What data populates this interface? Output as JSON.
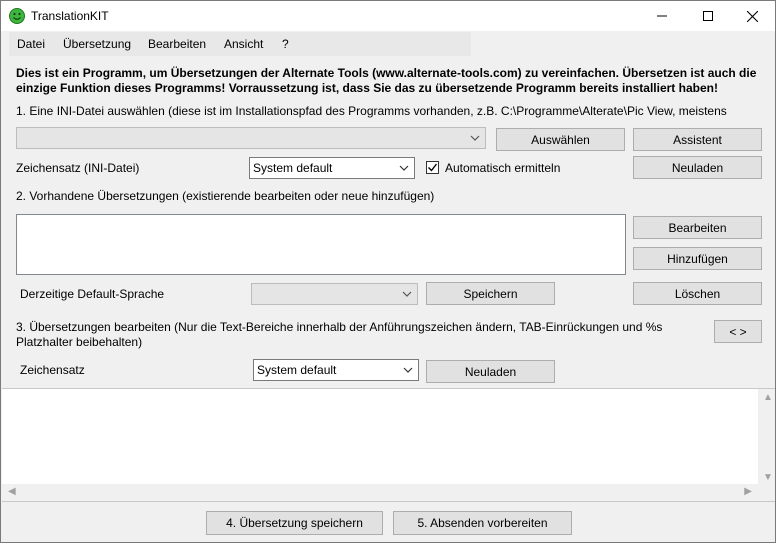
{
  "window": {
    "title": "TranslationKIT",
    "icon": "smiley-icon",
    "controls": [
      "minimize-icon",
      "maximize-icon",
      "close-icon"
    ]
  },
  "menu": [
    "Datei",
    "Übersetzung",
    "Bearbeiten",
    "Ansicht",
    "?"
  ],
  "intro": {
    "line1": "Dies ist ein Programm, um Übersetzungen der Alternate Tools (www.alternate-tools.com) zu vereinfachen. Übersetzen ist auch die",
    "line2": "einzige Funktion dieses Programms! Vorraussetzung ist, dass Sie das zu übersetzende Programm bereits installiert haben!"
  },
  "step1": {
    "label": "1. Eine INI-Datei auswählen (diese ist im Installationspfad des Programms vorhanden, z.B. C:\\Programme\\Alterate\\Pic View, meistens",
    "ini_value": "",
    "select_button": "Auswählen",
    "wizard_button": "Assistent",
    "charset_label": "Zeichensatz (INI-Datei)",
    "charset_value": "System default",
    "auto_detect_label": "Automatisch ermitteln",
    "auto_detect_checked": true,
    "reload_button": "Neuladen"
  },
  "step2": {
    "label": "2. Vorhandene Übersetzungen (existierende bearbeiten oder neue hinzufügen)",
    "edit_button": "Bearbeiten",
    "add_button": "Hinzufügen",
    "default_lang_label": "Derzeitige Default-Sprache",
    "default_lang_value": "",
    "save_button": "Speichern",
    "delete_button": "Löschen"
  },
  "step3": {
    "label_line1": "3. Übersetzungen bearbeiten (Nur die Text-Bereiche innerhalb der Anführungszeichen ändern, TAB-Einrückungen und %s",
    "label_line2": "Platzhalter beibehalten)",
    "toggle_button": "< >",
    "charset_label": "Zeichensatz",
    "charset_value": "System default",
    "reload_button": "Neuladen"
  },
  "footer": {
    "save_translation_button": "4. Übersetzung speichern",
    "prepare_submit_button": "5. Absenden vorbereiten"
  }
}
